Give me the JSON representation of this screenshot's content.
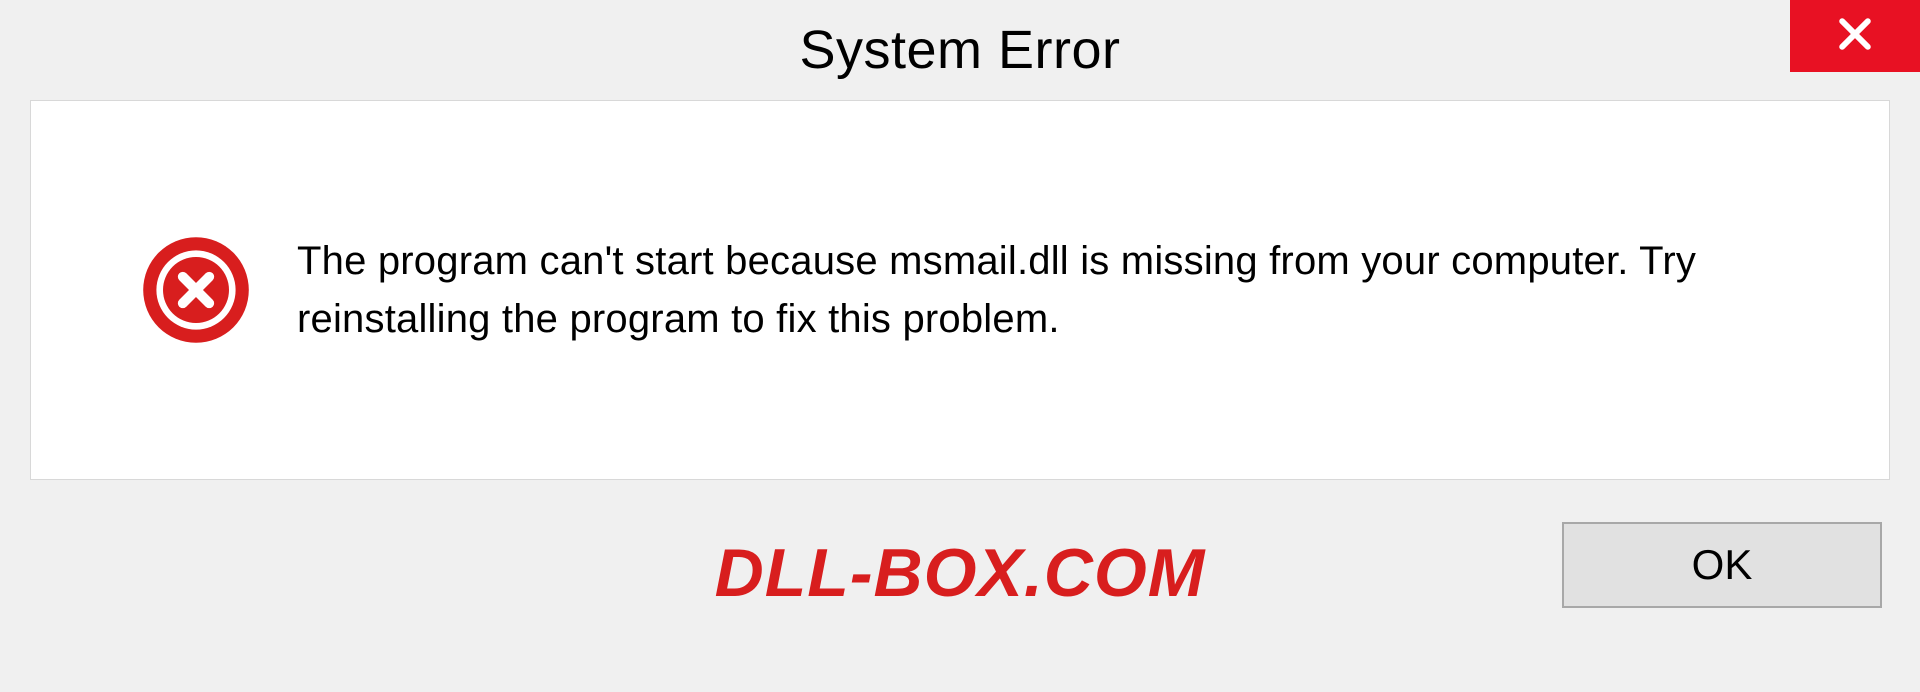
{
  "dialog": {
    "title": "System Error",
    "message": "The program can't start because msmail.dll is missing from your computer. Try reinstalling the program to fix this problem.",
    "ok_label": "OK"
  },
  "watermark": "DLL-BOX.COM",
  "colors": {
    "close_bg": "#e81123",
    "error_icon": "#d81e1e",
    "watermark": "#d81e1e"
  }
}
